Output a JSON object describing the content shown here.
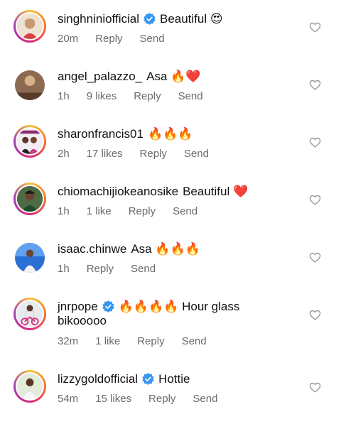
{
  "comments": [
    {
      "user": "singhniniofficial",
      "verified": true,
      "text": "Beautiful 😍",
      "time": "20m",
      "likes": "",
      "reply": "Reply",
      "send": "Send",
      "ring": true
    },
    {
      "user": "angel_palazzo_",
      "verified": false,
      "text": "Asa 🔥❤️",
      "time": "1h",
      "likes": "9 likes",
      "reply": "Reply",
      "send": "Send",
      "ring": false
    },
    {
      "user": "sharonfrancis01",
      "verified": false,
      "text": "🔥🔥🔥",
      "time": "2h",
      "likes": "17 likes",
      "reply": "Reply",
      "send": "Send",
      "ring": true
    },
    {
      "user": "chiomachijiokeanosike",
      "verified": false,
      "text": "Beautiful ❤️",
      "time": "1h",
      "likes": "1 like",
      "reply": "Reply",
      "send": "Send",
      "ring": true
    },
    {
      "user": "isaac.chinwe",
      "verified": false,
      "text": "Asa 🔥🔥🔥",
      "time": "1h",
      "likes": "",
      "reply": "Reply",
      "send": "Send",
      "ring": false
    },
    {
      "user": "jnrpope",
      "verified": true,
      "text": "🔥🔥🔥🔥 Hour glass bikooooo",
      "time": "32m",
      "likes": "1 like",
      "reply": "Reply",
      "send": "Send",
      "ring": true
    },
    {
      "user": "lizzygoldofficial",
      "verified": true,
      "text": "Hottie",
      "time": "54m",
      "likes": "15 likes",
      "reply": "Reply",
      "send": "Send",
      "ring": true
    }
  ],
  "colors": {
    "verified": "#3797f0",
    "meta": "#6b6b6b",
    "heart": "#9a9a9a"
  },
  "icons": {
    "like": "heart-outline-icon",
    "verified": "verified-badge-icon"
  }
}
